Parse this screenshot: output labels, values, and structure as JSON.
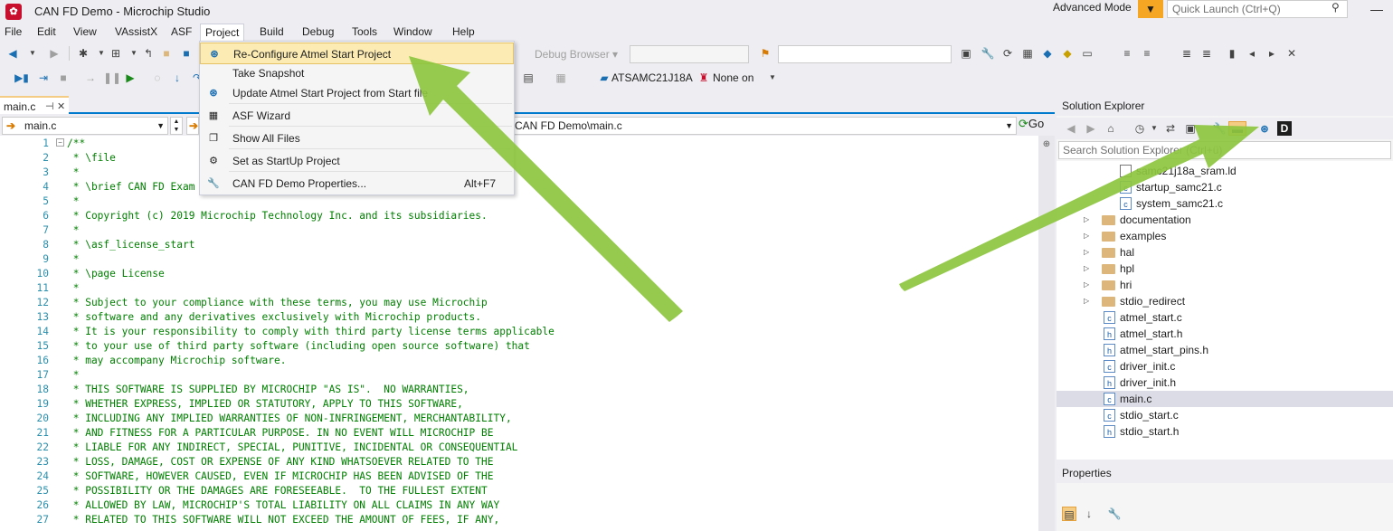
{
  "window": {
    "title": "CAN FD Demo - Microchip Studio",
    "mode": "Advanced Mode",
    "quick_launch_placeholder": "Quick Launch (Ctrl+Q)"
  },
  "menu": [
    "File",
    "Edit",
    "View",
    "VAssistX",
    "ASF",
    "Project",
    "Build",
    "Debug",
    "Tools",
    "Window",
    "Help"
  ],
  "toolbar": {
    "debug_browser": "Debug Browser",
    "device": "ATSAMC21J18A",
    "tool": "None on"
  },
  "editor": {
    "tab_label": "main.c",
    "nav_file": "main.c",
    "nav_path": "CAN FD Demo\\main.c",
    "go_label": "Go",
    "lines": [
      {
        "n": "1",
        "t": "/**"
      },
      {
        "n": "2",
        "t": " * \\file"
      },
      {
        "n": "3",
        "t": " *"
      },
      {
        "n": "4",
        "t": " * \\brief CAN FD Exam"
      },
      {
        "n": "5",
        "t": " *"
      },
      {
        "n": "6",
        "t": " * Copyright (c) 2019 Microchip Technology Inc. and its subsidiaries."
      },
      {
        "n": "7",
        "t": " *"
      },
      {
        "n": "8",
        "t": " * \\asf_license_start"
      },
      {
        "n": "9",
        "t": " *"
      },
      {
        "n": "10",
        "t": " * \\page License"
      },
      {
        "n": "11",
        "t": " *"
      },
      {
        "n": "12",
        "t": " * Subject to your compliance with these terms, you may use Microchip"
      },
      {
        "n": "13",
        "t": " * software and any derivatives exclusively with Microchip products."
      },
      {
        "n": "14",
        "t": " * It is your responsibility to comply with third party license terms applicable"
      },
      {
        "n": "15",
        "t": " * to your use of third party software (including open source software) that"
      },
      {
        "n": "16",
        "t": " * may accompany Microchip software."
      },
      {
        "n": "17",
        "t": " *"
      },
      {
        "n": "18",
        "t": " * THIS SOFTWARE IS SUPPLIED BY MICROCHIP \"AS IS\".  NO WARRANTIES,"
      },
      {
        "n": "19",
        "t": " * WHETHER EXPRESS, IMPLIED OR STATUTORY, APPLY TO THIS SOFTWARE,"
      },
      {
        "n": "20",
        "t": " * INCLUDING ANY IMPLIED WARRANTIES OF NON-INFRINGEMENT, MERCHANTABILITY,"
      },
      {
        "n": "21",
        "t": " * AND FITNESS FOR A PARTICULAR PURPOSE. IN NO EVENT WILL MICROCHIP BE"
      },
      {
        "n": "22",
        "t": " * LIABLE FOR ANY INDIRECT, SPECIAL, PUNITIVE, INCIDENTAL OR CONSEQUENTIAL"
      },
      {
        "n": "23",
        "t": " * LOSS, DAMAGE, COST OR EXPENSE OF ANY KIND WHATSOEVER RELATED TO THE"
      },
      {
        "n": "24",
        "t": " * SOFTWARE, HOWEVER CAUSED, EVEN IF MICROCHIP HAS BEEN ADVISED OF THE"
      },
      {
        "n": "25",
        "t": " * POSSIBILITY OR THE DAMAGES ARE FORESEEABLE.  TO THE FULLEST EXTENT"
      },
      {
        "n": "26",
        "t": " * ALLOWED BY LAW, MICROCHIP'S TOTAL LIABILITY ON ALL CLAIMS IN ANY WAY"
      },
      {
        "n": "27",
        "t": " * RELATED TO THIS SOFTWARE WILL NOT EXCEED THE AMOUNT OF FEES, IF ANY,"
      }
    ]
  },
  "project_menu": {
    "items": [
      {
        "label": "Re-Configure Atmel Start Project",
        "icon": "atmel-start-icon",
        "shortcut": "",
        "highlighted": true
      },
      {
        "label": "Take Snapshot",
        "icon": "",
        "shortcut": ""
      },
      {
        "label": "Update Atmel Start Project from Start file",
        "icon": "atmel-start-icon",
        "shortcut": ""
      },
      {
        "label": "ASF Wizard",
        "icon": "asf-wizard-icon",
        "shortcut": ""
      },
      {
        "label": "Show All Files",
        "icon": "show-all-files-icon",
        "shortcut": ""
      },
      {
        "label": "Set as StartUp Project",
        "icon": "gear-icon",
        "shortcut": ""
      },
      {
        "label": "CAN FD Demo Properties...",
        "icon": "wrench-icon",
        "shortcut": "Alt+F7"
      }
    ]
  },
  "solution_explorer": {
    "title": "Solution Explorer",
    "search_placeholder": "Search Solution Explorer (Ctrl+ü)",
    "items": [
      {
        "label": "samc21j18a_sram.ld",
        "type": "ld"
      },
      {
        "label": "startup_samc21.c",
        "type": "c"
      },
      {
        "label": "system_samc21.c",
        "type": "c"
      },
      {
        "label": "documentation",
        "type": "folder"
      },
      {
        "label": "examples",
        "type": "folder"
      },
      {
        "label": "hal",
        "type": "folder"
      },
      {
        "label": "hpl",
        "type": "folder"
      },
      {
        "label": "hri",
        "type": "folder"
      },
      {
        "label": "stdio_redirect",
        "type": "folder"
      },
      {
        "label": "atmel_start.c",
        "type": "c"
      },
      {
        "label": "atmel_start.h",
        "type": "h"
      },
      {
        "label": "atmel_start_pins.h",
        "type": "h"
      },
      {
        "label": "driver_init.c",
        "type": "c"
      },
      {
        "label": "driver_init.h",
        "type": "h"
      },
      {
        "label": "main.c",
        "type": "c",
        "selected": true
      },
      {
        "label": "stdio_start.c",
        "type": "c"
      },
      {
        "label": "stdio_start.h",
        "type": "h"
      }
    ]
  },
  "properties": {
    "title": "Properties"
  },
  "colors": {
    "accent": "#007acc",
    "highlight": "#fcecb4",
    "annotation_arrow": "#8dc63f"
  }
}
